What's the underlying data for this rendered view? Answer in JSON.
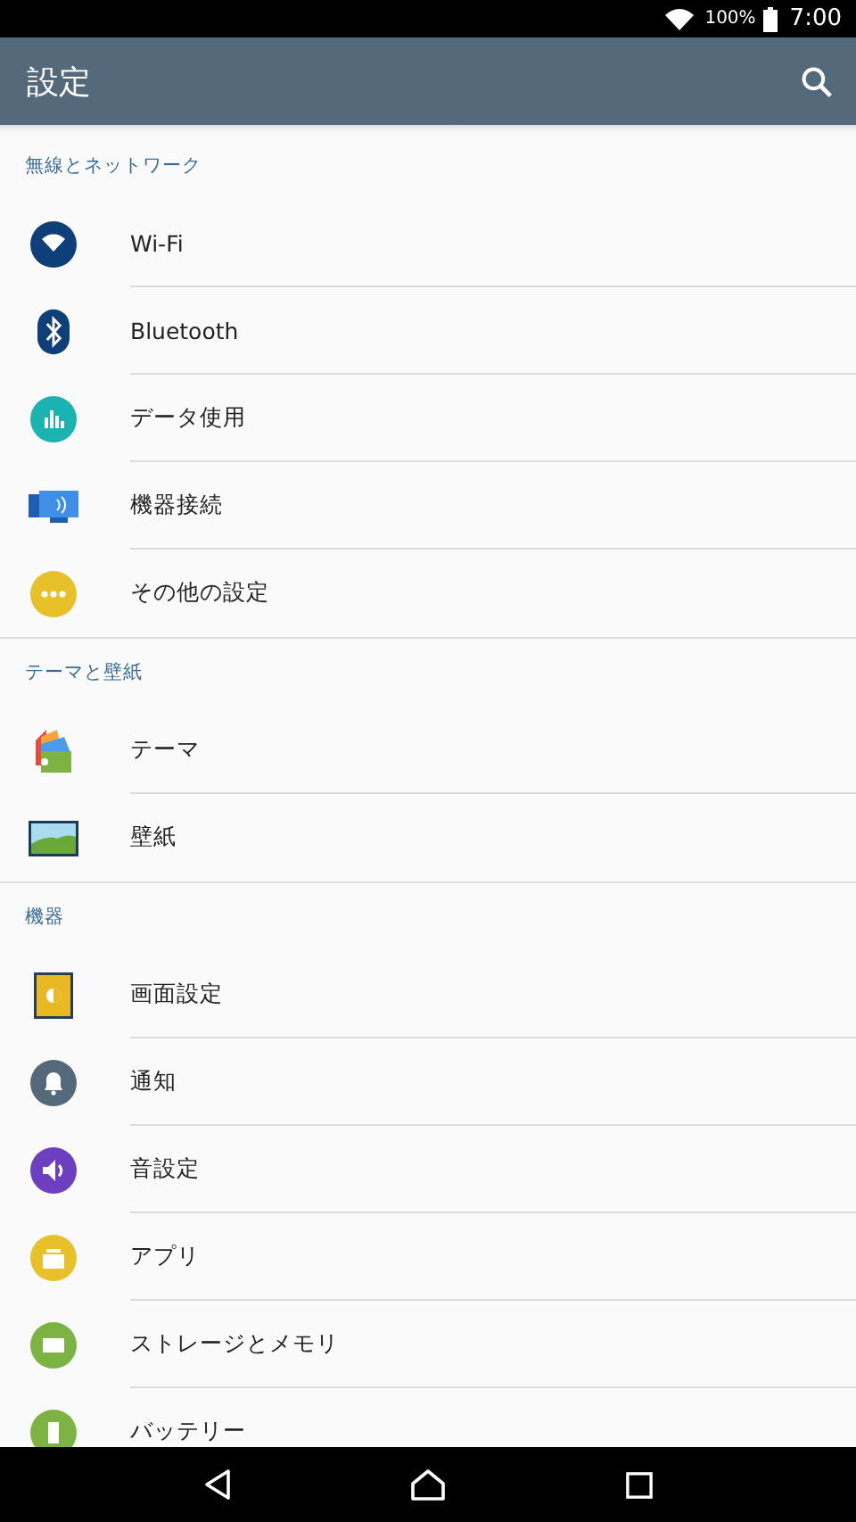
{
  "status_bar": {
    "battery": "100%",
    "time": "7:00"
  },
  "app_bar": {
    "title": "設定"
  },
  "sections": [
    {
      "title": "無線とネットワーク",
      "items": [
        {
          "label": "Wi-Fi"
        },
        {
          "label": "Bluetooth"
        },
        {
          "label": "データ使用"
        },
        {
          "label": "機器接続"
        },
        {
          "label": "その他の設定"
        }
      ]
    },
    {
      "title": "テーマと壁紙",
      "items": [
        {
          "label": "テーマ"
        },
        {
          "label": "壁紙"
        }
      ]
    },
    {
      "title": "機器",
      "items": [
        {
          "label": "画面設定"
        },
        {
          "label": "通知"
        },
        {
          "label": "音設定"
        },
        {
          "label": "アプリ"
        },
        {
          "label": "ストレージとメモリ"
        },
        {
          "label": "バッテリー"
        }
      ]
    }
  ]
}
